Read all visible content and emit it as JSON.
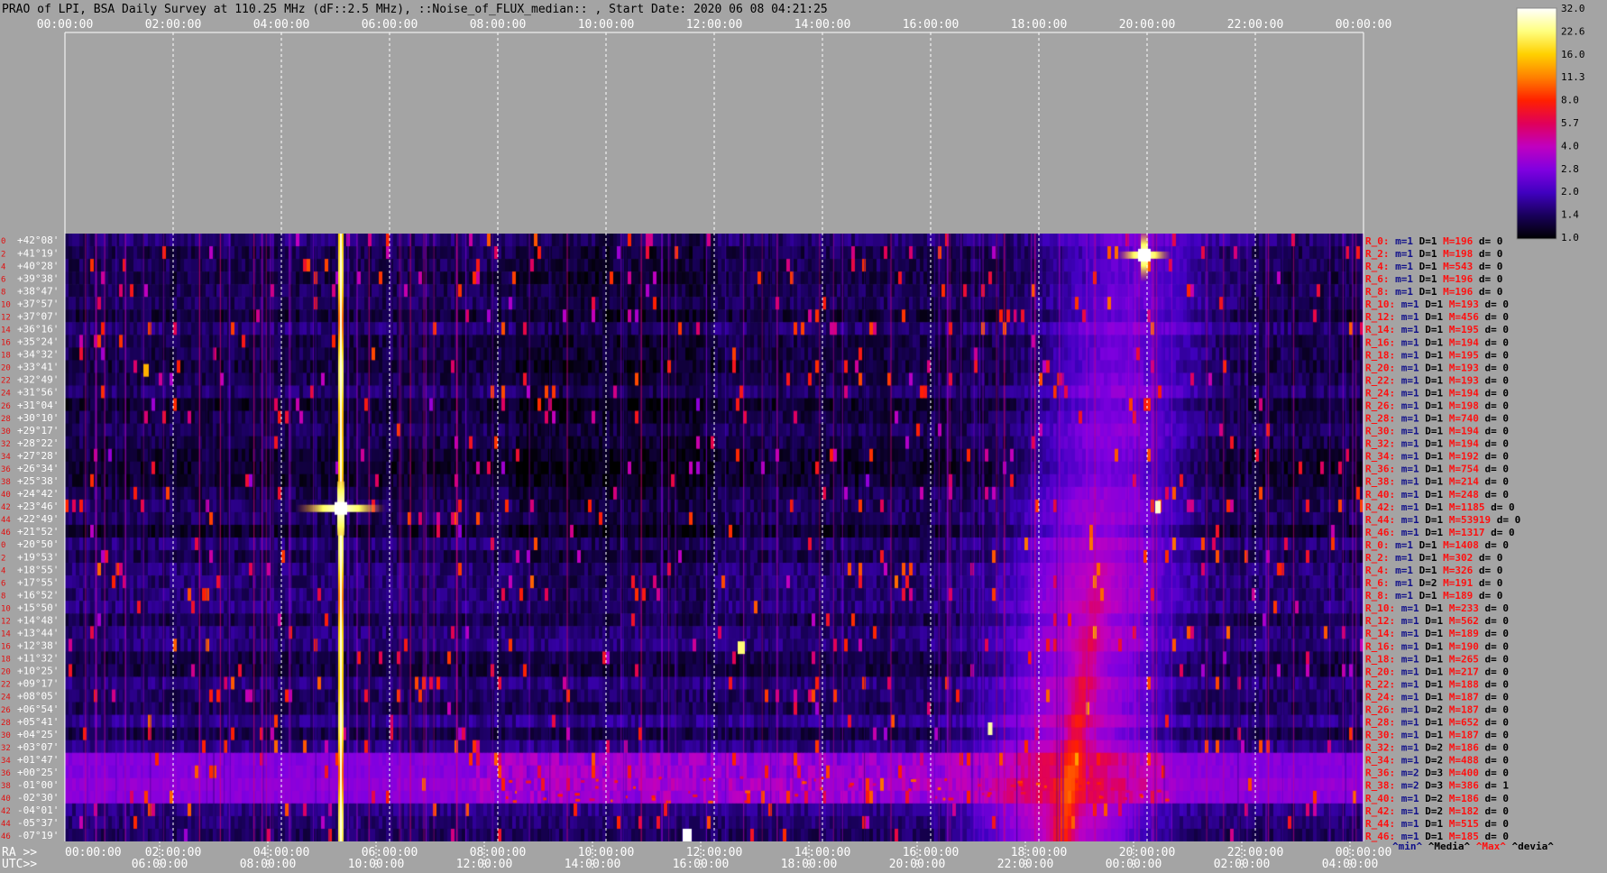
{
  "title": "PRAO of LPI, BSA Daily Survey at 110.25 MHz (dF::2.5 MHz), ::Noise_of_FLUX_median:: , Start Date: 2020 06 08 04:21:25",
  "top_axis_labels": [
    "00:00:00",
    "02:00:00",
    "04:00:00",
    "06:00:00",
    "08:00:00",
    "10:00:00",
    "12:00:00",
    "14:00:00",
    "16:00:00",
    "18:00:00",
    "20:00:00",
    "22:00:00",
    "00:00:00"
  ],
  "ra_prefix": "RA >>",
  "ra_axis_labels": [
    "00:00:00",
    "02:00:00",
    "04:00:00",
    "06:00:00",
    "08:00:00",
    "10:00:00",
    "12:00:00",
    "14:00:00",
    "16:00:00",
    "18:00:00",
    "20:00:00",
    "22:00:00",
    "00:00:00"
  ],
  "utc_prefix": "UTC>>",
  "utc_axis_labels": [
    "06:00:00",
    "08:00:00",
    "10:00:00",
    "12:00:00",
    "14:00:00",
    "16:00:00",
    "18:00:00",
    "20:00:00",
    "22:00:00",
    "00:00:00",
    "02:00:00",
    "04:00:00"
  ],
  "colorbar": {
    "ticks": [
      "32.0",
      "22.6",
      "16.0",
      "11.3",
      "8.0",
      "5.7",
      "4.0",
      "2.8",
      "2.0",
      "1.4",
      "1.0"
    ],
    "stops": [
      "#ffffff",
      "#ffff80",
      "#ffd000",
      "#ff8000",
      "#ff2000",
      "#e0005a",
      "#c000c0",
      "#8000e0",
      "#4000c0",
      "#180058",
      "#000000"
    ]
  },
  "beam_numbers": [
    "0",
    "2",
    "4",
    "6",
    "8",
    "10",
    "12",
    "14",
    "16",
    "18",
    "20",
    "22",
    "24",
    "26",
    "28",
    "30",
    "32",
    "34",
    "36",
    "38",
    "40",
    "42",
    "44",
    "46",
    "0",
    "2",
    "4",
    "6",
    "8",
    "10",
    "12",
    "14",
    "16",
    "18",
    "20",
    "22",
    "24",
    "26",
    "28",
    "30",
    "32",
    "34",
    "36",
    "38",
    "40",
    "42",
    "44",
    "46"
  ],
  "declinations": [
    "+42°08'",
    "+41°19'",
    "+40°28'",
    "+39°38'",
    "+38°47'",
    "+37°57'",
    "+37°07'",
    "+36°16'",
    "+35°24'",
    "+34°32'",
    "+33°41'",
    "+32°49'",
    "+31°56'",
    "+31°04'",
    "+30°10'",
    "+29°17'",
    "+28°22'",
    "+27°28'",
    "+26°34'",
    "+25°38'",
    "+24°42'",
    "+23°46'",
    "+22°49'",
    "+21°52'",
    "+20°50'",
    "+19°53'",
    "+18°55'",
    "+17°55'",
    "+16°52'",
    "+15°50'",
    "+14°48'",
    "+13°44'",
    "+12°38'",
    "+11°32'",
    "+10°25'",
    "+09°17'",
    "+08°05'",
    "+06°54'",
    "+05°41'",
    "+04°25'",
    "+03°07'",
    "+01°47'",
    "+00°25'",
    "-01°00'",
    "-02°30'",
    "-04°01'",
    "-05°37'",
    "-07°19'"
  ],
  "stats": [
    {
      "r": "R_0:",
      "m": "m=1",
      "d": "D=1",
      "M": "M=196",
      "dv": "d= 0"
    },
    {
      "r": "R_2:",
      "m": "m=1",
      "d": "D=1",
      "M": "M=198",
      "dv": "d= 0"
    },
    {
      "r": "R_4:",
      "m": "m=1",
      "d": "D=1",
      "M": "M=543",
      "dv": "d= 0"
    },
    {
      "r": "R_6:",
      "m": "m=1",
      "d": "D=1",
      "M": "M=196",
      "dv": "d= 0"
    },
    {
      "r": "R_8:",
      "m": "m=1",
      "d": "D=1",
      "M": "M=196",
      "dv": "d= 0"
    },
    {
      "r": "R_10:",
      "m": "m=1",
      "d": "D=1",
      "M": "M=193",
      "dv": "d= 0"
    },
    {
      "r": "R_12:",
      "m": "m=1",
      "d": "D=1",
      "M": "M=456",
      "dv": "d= 0"
    },
    {
      "r": "R_14:",
      "m": "m=1",
      "d": "D=1",
      "M": "M=195",
      "dv": "d= 0"
    },
    {
      "r": "R_16:",
      "m": "m=1",
      "d": "D=1",
      "M": "M=194",
      "dv": "d= 0"
    },
    {
      "r": "R_18:",
      "m": "m=1",
      "d": "D=1",
      "M": "M=195",
      "dv": "d= 0"
    },
    {
      "r": "R_20:",
      "m": "m=1",
      "d": "D=1",
      "M": "M=193",
      "dv": "d= 0"
    },
    {
      "r": "R_22:",
      "m": "m=1",
      "d": "D=1",
      "M": "M=193",
      "dv": "d= 0"
    },
    {
      "r": "R_24:",
      "m": "m=1",
      "d": "D=1",
      "M": "M=194",
      "dv": "d= 0"
    },
    {
      "r": "R_26:",
      "m": "m=1",
      "d": "D=1",
      "M": "M=198",
      "dv": "d= 0"
    },
    {
      "r": "R_28:",
      "m": "m=1",
      "d": "D=1",
      "M": "M=740",
      "dv": "d= 0"
    },
    {
      "r": "R_30:",
      "m": "m=1",
      "d": "D=1",
      "M": "M=194",
      "dv": "d= 0"
    },
    {
      "r": "R_32:",
      "m": "m=1",
      "d": "D=1",
      "M": "M=194",
      "dv": "d= 0"
    },
    {
      "r": "R_34:",
      "m": "m=1",
      "d": "D=1",
      "M": "M=192",
      "dv": "d= 0"
    },
    {
      "r": "R_36:",
      "m": "m=1",
      "d": "D=1",
      "M": "M=754",
      "dv": "d= 0"
    },
    {
      "r": "R_38:",
      "m": "m=1",
      "d": "D=1",
      "M": "M=214",
      "dv": "d= 0"
    },
    {
      "r": "R_40:",
      "m": "m=1",
      "d": "D=1",
      "M": "M=248",
      "dv": "d= 0"
    },
    {
      "r": "R_42:",
      "m": "m=1",
      "d": "D=1",
      "M": "M=1185",
      "dv": "d= 0"
    },
    {
      "r": "R_44:",
      "m": "m=1",
      "d": "D=1",
      "M": "M=53919",
      "dv": "d= 0"
    },
    {
      "r": "R_46:",
      "m": "m=1",
      "d": "D=1",
      "M": "M=1317",
      "dv": "d= 0"
    },
    {
      "r": "R_0:",
      "m": "m=1",
      "d": "D=1",
      "M": "M=1408",
      "dv": "d= 0"
    },
    {
      "r": "R_2:",
      "m": "m=1",
      "d": "D=1",
      "M": "M=302",
      "dv": "d= 0"
    },
    {
      "r": "R_4:",
      "m": "m=1",
      "d": "D=1",
      "M": "M=326",
      "dv": "d= 0"
    },
    {
      "r": "R_6:",
      "m": "m=1",
      "d": "D=2",
      "M": "M=191",
      "dv": "d= 0"
    },
    {
      "r": "R_8:",
      "m": "m=1",
      "d": "D=1",
      "M": "M=189",
      "dv": "d= 0"
    },
    {
      "r": "R_10:",
      "m": "m=1",
      "d": "D=1",
      "M": "M=233",
      "dv": "d= 0"
    },
    {
      "r": "R_12:",
      "m": "m=1",
      "d": "D=1",
      "M": "M=562",
      "dv": "d= 0"
    },
    {
      "r": "R_14:",
      "m": "m=1",
      "d": "D=1",
      "M": "M=189",
      "dv": "d= 0"
    },
    {
      "r": "R_16:",
      "m": "m=1",
      "d": "D=1",
      "M": "M=190",
      "dv": "d= 0"
    },
    {
      "r": "R_18:",
      "m": "m=1",
      "d": "D=1",
      "M": "M=265",
      "dv": "d= 0"
    },
    {
      "r": "R_20:",
      "m": "m=1",
      "d": "D=1",
      "M": "M=217",
      "dv": "d= 0"
    },
    {
      "r": "R_22:",
      "m": "m=1",
      "d": "D=1",
      "M": "M=188",
      "dv": "d= 0"
    },
    {
      "r": "R_24:",
      "m": "m=1",
      "d": "D=1",
      "M": "M=187",
      "dv": "d= 0"
    },
    {
      "r": "R_26:",
      "m": "m=1",
      "d": "D=2",
      "M": "M=187",
      "dv": "d= 0"
    },
    {
      "r": "R_28:",
      "m": "m=1",
      "d": "D=1",
      "M": "M=652",
      "dv": "d= 0"
    },
    {
      "r": "R_30:",
      "m": "m=1",
      "d": "D=1",
      "M": "M=187",
      "dv": "d= 0"
    },
    {
      "r": "R_32:",
      "m": "m=1",
      "d": "D=2",
      "M": "M=186",
      "dv": "d= 0"
    },
    {
      "r": "R_34:",
      "m": "m=1",
      "d": "D=2",
      "M": "M=488",
      "dv": "d= 0"
    },
    {
      "r": "R_36:",
      "m": "m=2",
      "d": "D=3",
      "M": "M=400",
      "dv": "d= 0"
    },
    {
      "r": "R_38:",
      "m": "m=2",
      "d": "D=3",
      "M": "M=386",
      "dv": "d= 1"
    },
    {
      "r": "R_40:",
      "m": "m=1",
      "d": "D=2",
      "M": "M=186",
      "dv": "d= 0"
    },
    {
      "r": "R_42:",
      "m": "m=1",
      "d": "D=2",
      "M": "M=182",
      "dv": "d= 0"
    },
    {
      "r": "R_44:",
      "m": "m=1",
      "d": "D=1",
      "M": "M=515",
      "dv": "d= 0"
    },
    {
      "r": "R_46:",
      "m": "m=1",
      "d": "D=1",
      "M": "M=185",
      "dv": "d= 0"
    }
  ],
  "stat_footer": {
    "min": "^min^",
    "media": "^Media^",
    "max": "^Max^",
    "devia": "^devia^"
  },
  "colors": {
    "background": "#a4a4a4",
    "grid": "#ffffff",
    "beam_label": "#e01010",
    "decl_label": "#ffffff",
    "stat_r": "#ff1010",
    "stat_m": "#10108a",
    "stat_d": "#000000",
    "stat_M": "#ff1010",
    "footer_min": "#10108a",
    "footer_max": "#ff1010"
  },
  "chart_data": {
    "type": "heatmap",
    "title": "PRAO of LPI, BSA Daily Survey at 110.25 MHz (dF::2.5 MHz), ::Noise_of_FLUX_median:: , Start Date: 2020 06 08 04:21:25",
    "x_axis": "RA (sidereal time)",
    "x_range_hours": [
      0,
      24
    ],
    "rows": 48,
    "color_scale": "log",
    "value_range": [
      1.0,
      32.0
    ],
    "features": [
      {
        "label": "strong source track",
        "ra_hours": 5.1,
        "declination": "+22°49'",
        "peak": 32.0
      },
      {
        "label": "strong source",
        "ra_hours": 19.95,
        "declination": "+40°28'",
        "peak": 32.0
      },
      {
        "label": "galactic plane band",
        "ra_hours_top": 19.8,
        "ra_hours_bottom": 18.7,
        "peak": 11.3
      },
      {
        "label": "equatorial band",
        "declination": "-01°00'",
        "ra_hours_range": [
          8.0,
          20.5
        ],
        "peak": 8.0
      },
      {
        "label": "compact source",
        "ra_hours": 12.5,
        "declination": "+12°38'",
        "peak": 22.6
      },
      {
        "label": "compact source",
        "ra_hours": 11.5,
        "declination": "-07°19'",
        "peak": 32.0
      }
    ]
  }
}
